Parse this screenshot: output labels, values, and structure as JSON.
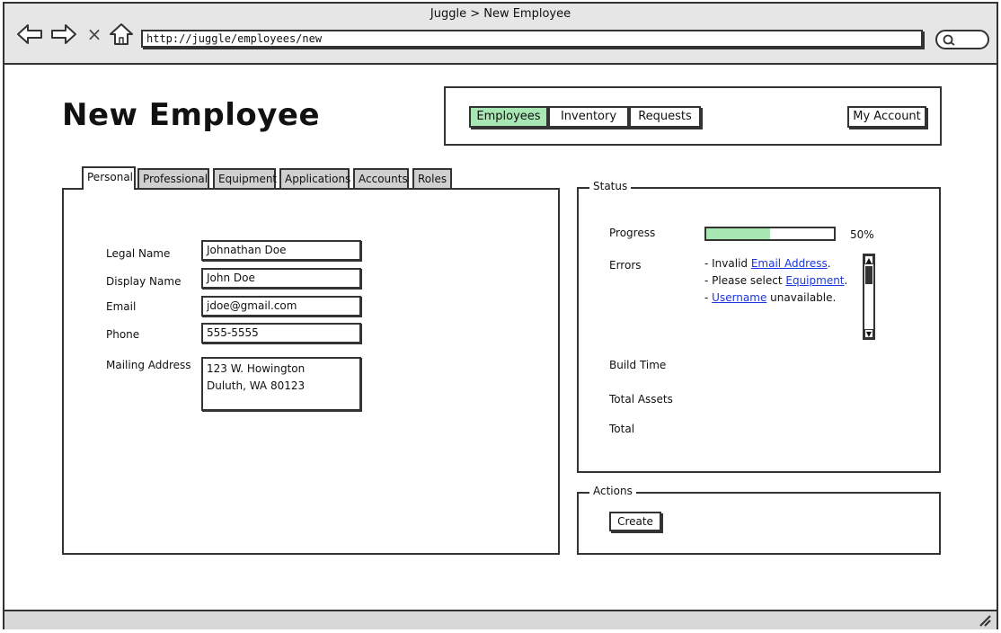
{
  "window": {
    "title": "Juggle > New Employee"
  },
  "browser": {
    "back_icon": "arrow-left-icon",
    "forward_icon": "arrow-right-icon",
    "stop_icon": "x-icon",
    "home_icon": "home-icon",
    "stop_glyph": "×",
    "url": "http://juggle/employees/new",
    "search_icon": "search-icon"
  },
  "page": {
    "title": "New Employee"
  },
  "topnav": {
    "items": [
      {
        "label": "Employees",
        "active": true
      },
      {
        "label": "Inventory"
      },
      {
        "label": "Requests"
      }
    ],
    "account_label": "My Account"
  },
  "tabs": [
    "Personal",
    "Professional",
    "Equipment",
    "Applications",
    "Accounts",
    "Roles"
  ],
  "personal": {
    "legal_name_label": "Legal Name",
    "legal_name_value": "Johnathan Doe",
    "display_name_label": "Display Name",
    "display_name_value": "John Doe",
    "email_label": "Email",
    "email_value": "jdoe@gmail.com",
    "phone_label": "Phone",
    "phone_value": "555-5555",
    "mailing_label": "Mailing Address",
    "mailing_line1": "123 W. Howington",
    "mailing_line2": "Duluth, WA 80123"
  },
  "status": {
    "legend": "Status",
    "progress_label": "Progress",
    "progress_fraction": 0.5,
    "progress_text": "50%",
    "errors_label": "Errors",
    "errors": [
      {
        "prefix": "- Invalid ",
        "link": "Email Address",
        "suffix": "."
      },
      {
        "prefix": "- Please select ",
        "link": "Equipment",
        "suffix": "."
      },
      {
        "prefix": "- ",
        "link": "Username",
        "suffix": " unavailable."
      }
    ],
    "build_time_label": "Build Time",
    "total_assets_label": "Total Assets",
    "total_label": "Total"
  },
  "actions": {
    "legend": "Actions",
    "create_label": "Create"
  },
  "colors": {
    "accent_green": "#a8e6b4",
    "link_blue": "#1a36e0"
  }
}
